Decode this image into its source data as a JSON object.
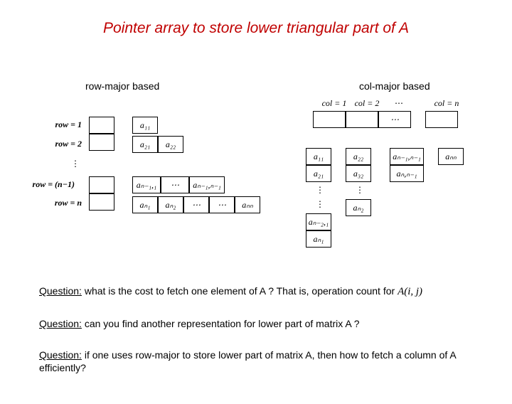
{
  "title": "Pointer array to store lower triangular part of  A",
  "row_heading": "row-major based",
  "col_heading": "col-major based",
  "row_labels": {
    "r1": "row = 1",
    "r2": "row = 2",
    "rn1": "row = (n−1)",
    "rn": "row = n"
  },
  "col_labels": {
    "c1": "col = 1",
    "c2": "col = 2",
    "cn": "col = n"
  },
  "cells": {
    "a11": "a₁₁",
    "a21": "a₂₁",
    "a22": "a₂₂",
    "an1": "aₙ₁",
    "an2": "aₙ₂",
    "ann": "aₙₙ",
    "an11": "aₙ₋₁,₁",
    "an1n1": "aₙ₋₁,ₙ₋₁",
    "a32": "a₃₂",
    "ann1": "aₙ,ₙ₋₁",
    "an21": "aₙ₋₂,₁"
  },
  "dots_h": "⋯",
  "dots_v": "⋮",
  "q1_label": "Question:",
  "q1": " what is the cost to fetch one element of A ? That is, operation count for ",
  "Aij": "A(i, j)",
  "q2_label": "Question:",
  "q2": " can you find another representation for lower part of matrix A ?",
  "q3_label": "Question:",
  "q3": " if one uses row-major to store lower part of matrix A, then how to fetch a column of A efficiently?"
}
